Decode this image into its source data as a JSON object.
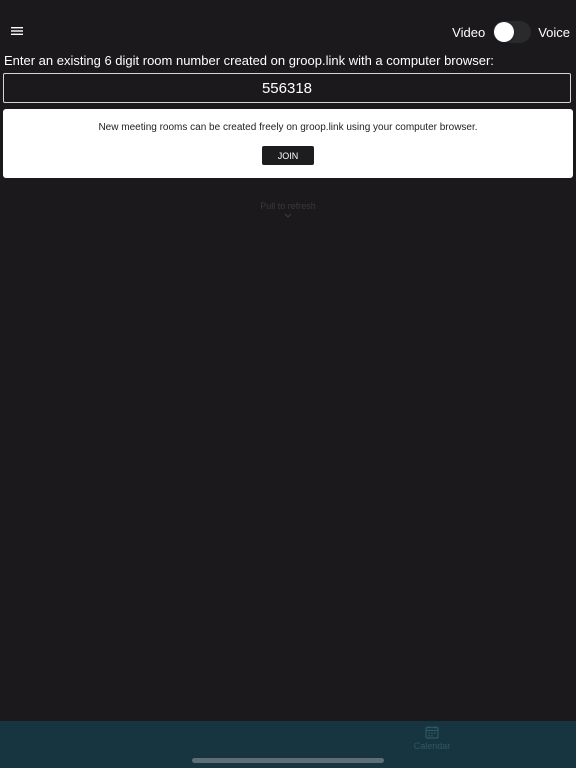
{
  "topbar": {
    "menu_icon": "hamburger-menu-icon",
    "toggle": {
      "left_label": "Video",
      "right_label": "Voice",
      "state": "video"
    }
  },
  "main": {
    "prompt": "Enter an existing 6 digit room number created on groop.link with a computer browser:",
    "room_input_value": "556318",
    "info_text": "New meeting rooms can be created freely on groop.link using your computer browser.",
    "join_label": "JOIN",
    "refresh_hint": "Pull to refresh"
  },
  "bottom_tabs": [
    {
      "label": "Calendar",
      "icon": "calendar-icon"
    }
  ],
  "colors": {
    "background": "#1b191c",
    "card": "#ffffff",
    "button": "#1d1c1f",
    "tab_bar": "#173541"
  }
}
